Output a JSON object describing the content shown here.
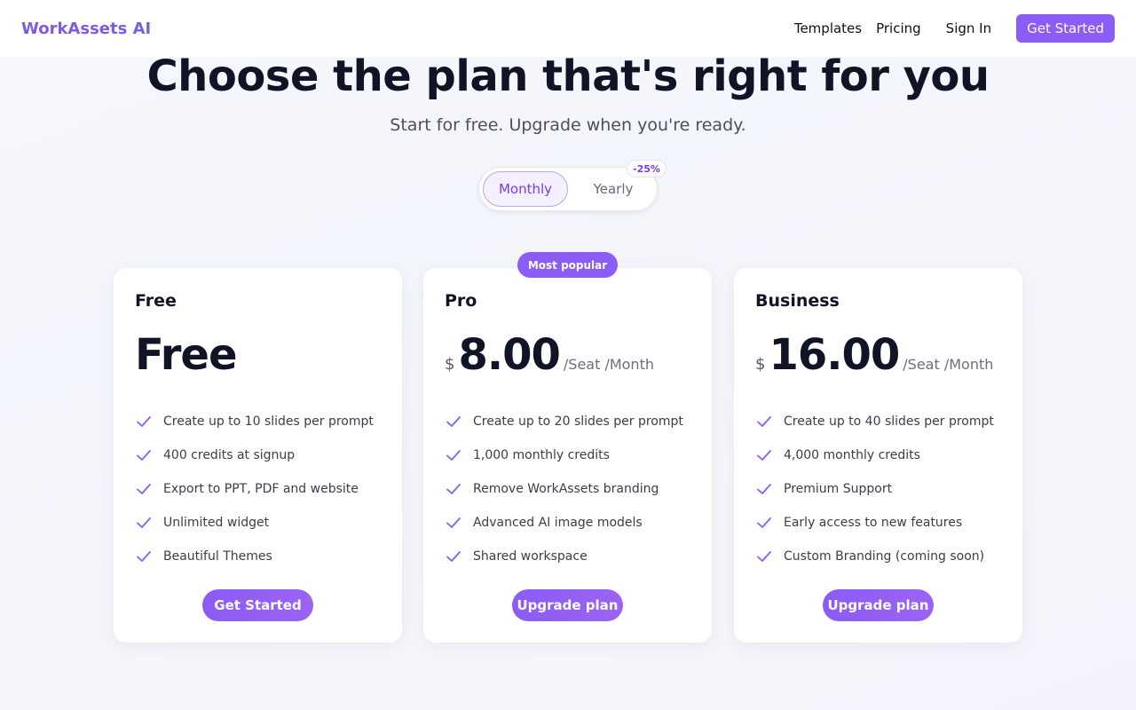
{
  "nav": {
    "brand": "WorkAssets AI",
    "links": [
      "Templates",
      "Pricing"
    ],
    "sign_in": "Sign In",
    "cta": "Get Started"
  },
  "hero": {
    "title": "Choose the plan that's right for you",
    "subtitle": "Start for free. Upgrade when you're ready."
  },
  "billing_toggle": {
    "monthly": "Monthly",
    "yearly": "Yearly",
    "discount": "-25%",
    "selected": "Monthly"
  },
  "plans": [
    {
      "name": "Free",
      "price": "Free",
      "features": [
        "Create up to 10 slides per prompt",
        "400 credits at signup",
        "Export to PPT, PDF and website",
        "Unlimited widget",
        "Beautiful Themes"
      ],
      "cta": "Get Started"
    },
    {
      "name": "Pro",
      "badge": "Most popular",
      "currency": "$",
      "price": "8.00",
      "period": "/Seat /Month",
      "features": [
        "Create up to 20 slides per prompt",
        "1,000 monthly credits",
        "Remove WorkAssets branding",
        "Advanced AI image models",
        "Shared workspace"
      ],
      "cta": "Upgrade plan"
    },
    {
      "name": "Business",
      "currency": "$",
      "price": "16.00",
      "period": "/Seat /Month",
      "features": [
        "Create up to 40 slides per prompt",
        "4,000 monthly credits",
        "Premium Support",
        "Early access to new features",
        "Custom Branding (coming soon)"
      ],
      "cta": "Upgrade plan"
    }
  ],
  "colors": {
    "accent": "#8b5cf6",
    "brand": "#7c5ce6",
    "check": "#8b5cf6"
  }
}
